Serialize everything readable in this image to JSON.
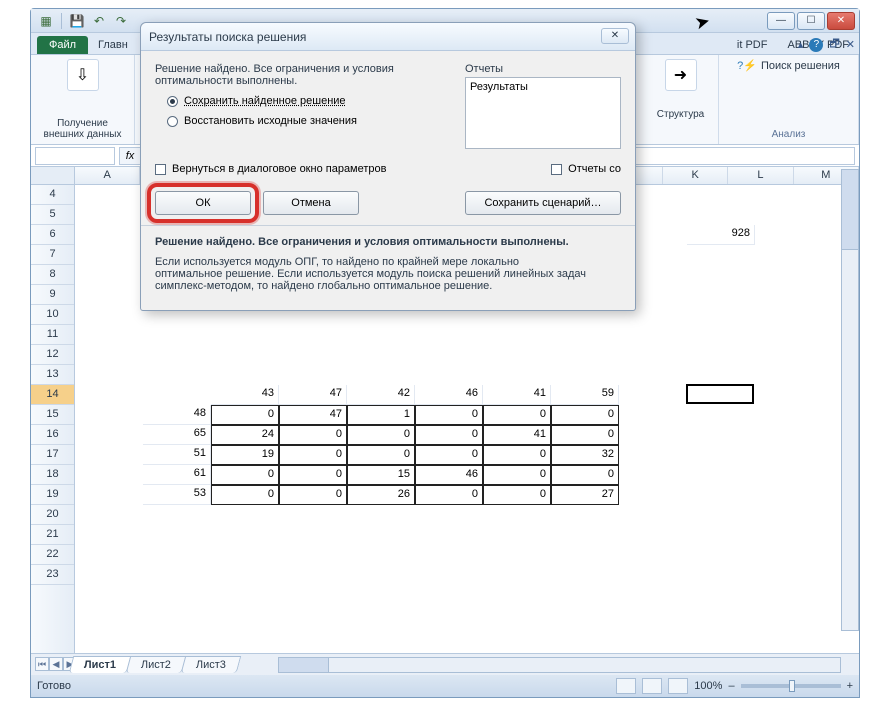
{
  "window": {
    "min_glyph": "—",
    "max_glyph": "☐",
    "close_glyph": "✕"
  },
  "qat": {
    "excel_glyph": "▦",
    "save_glyph": "💾",
    "undo_glyph": "↶",
    "redo_glyph": "↷"
  },
  "ribbon": {
    "file_tab": "Файл",
    "home_tab": "Главн",
    "it_pdf": "it PDF",
    "abbyy": "ABBYY PDF",
    "help_glyph": "?",
    "ext_data_label": "Получение\nвнешних данных",
    "structure_label": "Структура",
    "solver_label": "Поиск решения",
    "analysis_title": "Анализ",
    "arrow_glyph": "➜",
    "icon_glyph": "⇩"
  },
  "formula": {
    "fx": "fx"
  },
  "columns": [
    "A",
    "",
    "",
    "",
    "",
    "",
    "",
    "",
    "",
    "K",
    "L",
    "M"
  ],
  "rows_visible": [
    4,
    5,
    6,
    7,
    8,
    9,
    10,
    11,
    12,
    13,
    14,
    15,
    16,
    17,
    18,
    19,
    20,
    21,
    22,
    23
  ],
  "selected_row": 14,
  "cells": {
    "K6": "928"
  },
  "chart_data": {
    "type": "table",
    "header_row": [
      43,
      47,
      42,
      46,
      41,
      59
    ],
    "row_labels": [
      48,
      65,
      51,
      61,
      53
    ],
    "body": [
      [
        0,
        47,
        1,
        0,
        0,
        0
      ],
      [
        24,
        0,
        0,
        0,
        41,
        0
      ],
      [
        19,
        0,
        0,
        0,
        0,
        32
      ],
      [
        0,
        0,
        15,
        46,
        0,
        0
      ],
      [
        0,
        0,
        26,
        0,
        0,
        27
      ]
    ]
  },
  "sheets": {
    "s1": "Лист1",
    "s2": "Лист2",
    "s3": "Лист3"
  },
  "status": {
    "ready": "Готово",
    "zoom": "100%",
    "plus": "+",
    "minus": "–"
  },
  "dialog": {
    "title": "Результаты поиска решения",
    "close_glyph": "✕",
    "msg1a": "Решение найдено. Все ограничения и условия",
    "msg1b": "оптимальности выполнены.",
    "reports_label": "Отчеты",
    "reports_item": "Результаты",
    "opt_keep": "Сохранить найденное решение",
    "opt_restore": "Восстановить исходные значения",
    "chk_return": "Вернуться в диалоговое окно параметров",
    "chk_reports": "Отчеты со",
    "ok": "ОК",
    "cancel": "Отмена",
    "save_scenario": "Сохранить сценарий…",
    "bold_msg": "Решение найдено. Все ограничения и условия оптимальности выполнены.",
    "detail1": "Если используется модуль ОПГ, то найдено по крайней мере локально",
    "detail2": "оптимальное решение. Если используется модуль поиска решений линейных задач",
    "detail3": "симплекс-методом, то найдено глобально оптимальное решение."
  }
}
